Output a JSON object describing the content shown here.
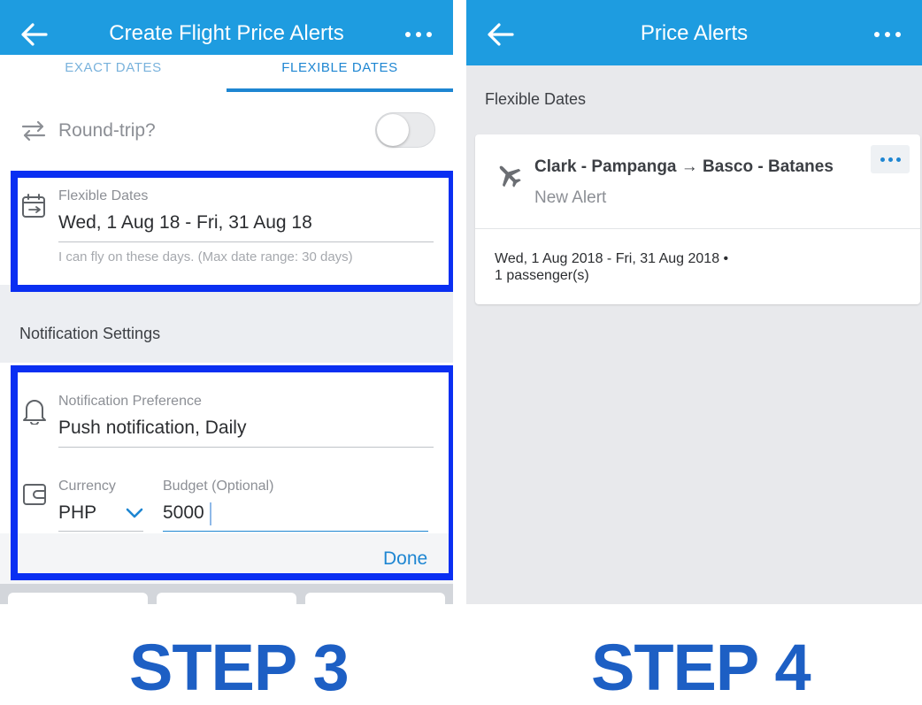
{
  "left_screen": {
    "title": "Create Flight Price Alerts",
    "tabs": [
      "EXACT DATES",
      "FLEXIBLE DATES"
    ],
    "roundtrip_label": "Round-trip?",
    "flexible_dates": {
      "label": "Flexible Dates",
      "value": "Wed, 1 Aug 18 - Fri, 31 Aug 18",
      "hint": "I can fly on these days. (Max date range: 30 days)"
    },
    "notification_section": "Notification Settings",
    "notification_pref": {
      "label": "Notification Preference",
      "value": "Push notification, Daily"
    },
    "currency": {
      "label": "Currency",
      "value": "PHP"
    },
    "budget": {
      "label": "Budget (Optional)",
      "value": "5000"
    },
    "done_label": "Done"
  },
  "right_screen": {
    "title": "Price Alerts",
    "section": "Flexible Dates",
    "alert": {
      "route": "Clark - Pampanga → Basco - Batanes",
      "status": "New Alert",
      "dates": "Wed, 1 Aug 2018 - Fri, 31 Aug 2018 •",
      "passengers": "1 passenger(s)"
    }
  },
  "captions": {
    "step3": "STEP 3",
    "step4": "STEP 4"
  },
  "colors": {
    "app_bar": "#1e9ce0",
    "accent": "#1e86d2",
    "highlight_box": "#0a2ff2",
    "caption": "#1d5fc4"
  },
  "icons": [
    "back-arrow-icon",
    "more-icon",
    "roundtrip-icon",
    "calendar-icon",
    "bell-icon",
    "wallet-icon",
    "chevron-down-icon",
    "airplane-icon"
  ]
}
